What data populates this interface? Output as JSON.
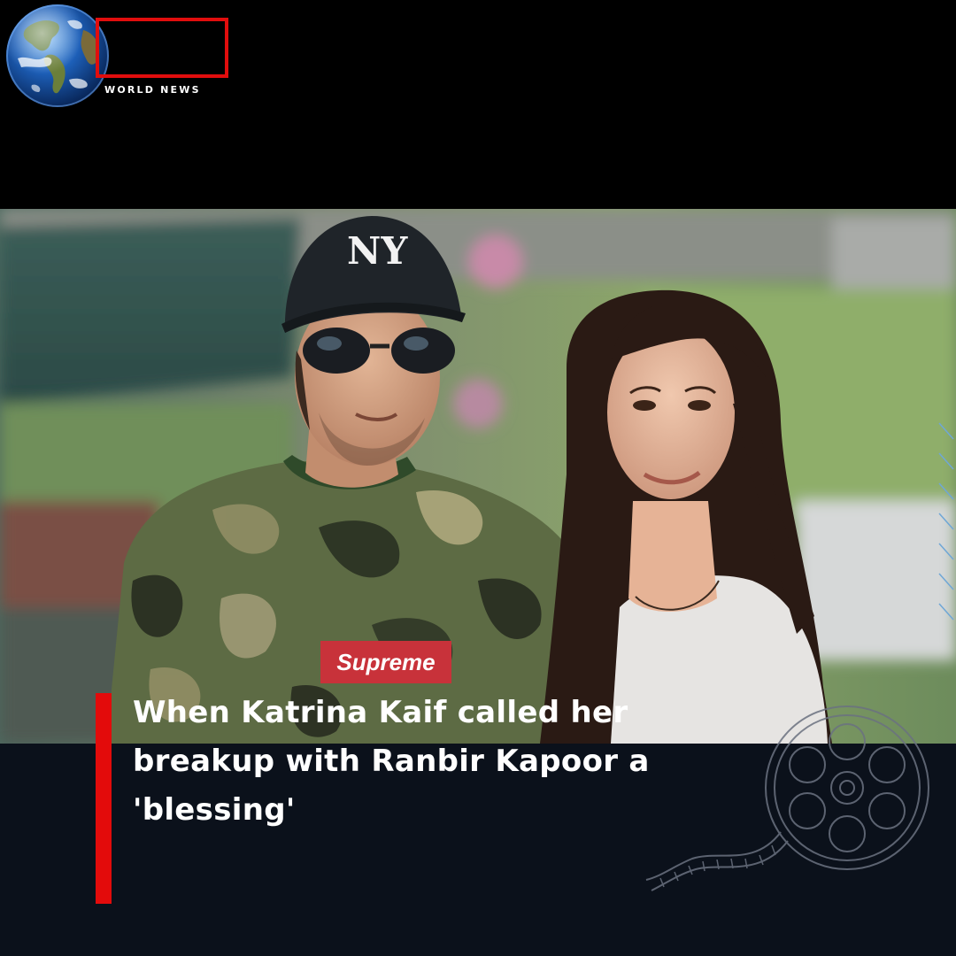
{
  "brand": {
    "name": "WORLD NEWS",
    "accent_color": "#e10d0d",
    "logo_icon": "globe-icon"
  },
  "photo": {
    "cap_logo": "NY",
    "shirt_logo": "Supreme"
  },
  "headline": {
    "text": "When Katrina Kaif called her breakup with Ranbir Kapoor a 'blessing'"
  },
  "decoration": {
    "icon": "film-reel-icon"
  }
}
